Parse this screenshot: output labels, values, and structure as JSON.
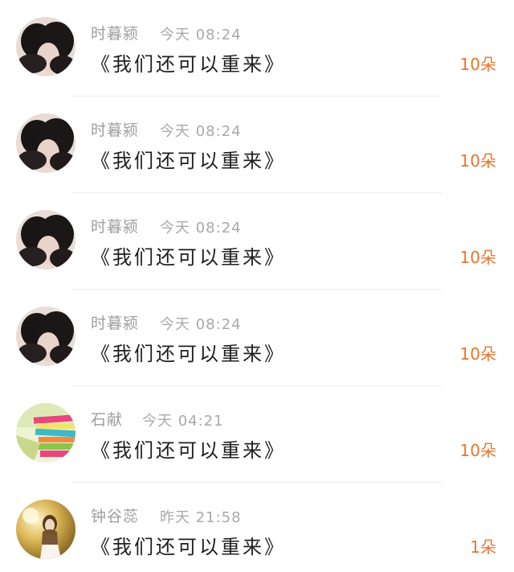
{
  "items": [
    {
      "user": "时暮颍",
      "time": "今天 08:24",
      "title": "《我们还可以重来》",
      "count": "10朵",
      "avatar": "couple-avatar-icon"
    },
    {
      "user": "时暮颍",
      "time": "今天 08:24",
      "title": "《我们还可以重来》",
      "count": "10朵",
      "avatar": "couple-avatar-icon"
    },
    {
      "user": "时暮颍",
      "time": "今天 08:24",
      "title": "《我们还可以重来》",
      "count": "10朵",
      "avatar": "couple-avatar-icon"
    },
    {
      "user": "时暮颍",
      "time": "今天 08:24",
      "title": "《我们还可以重来》",
      "count": "10朵",
      "avatar": "couple-avatar-icon"
    },
    {
      "user": "石献",
      "time": "今天 04:21",
      "title": "《我们还可以重来》",
      "count": "10朵",
      "avatar": "books-avatar-icon"
    },
    {
      "user": "钟谷蕊",
      "time": "昨天 21:58",
      "title": "《我们还可以重来》",
      "count": "1朵",
      "avatar": "girl-avatar-icon"
    }
  ],
  "colors": {
    "name": "#9e9e9e",
    "time": "#a9a9a9",
    "title": "#1f1f1f",
    "count": "#e8762c",
    "divider": "#ececec"
  }
}
